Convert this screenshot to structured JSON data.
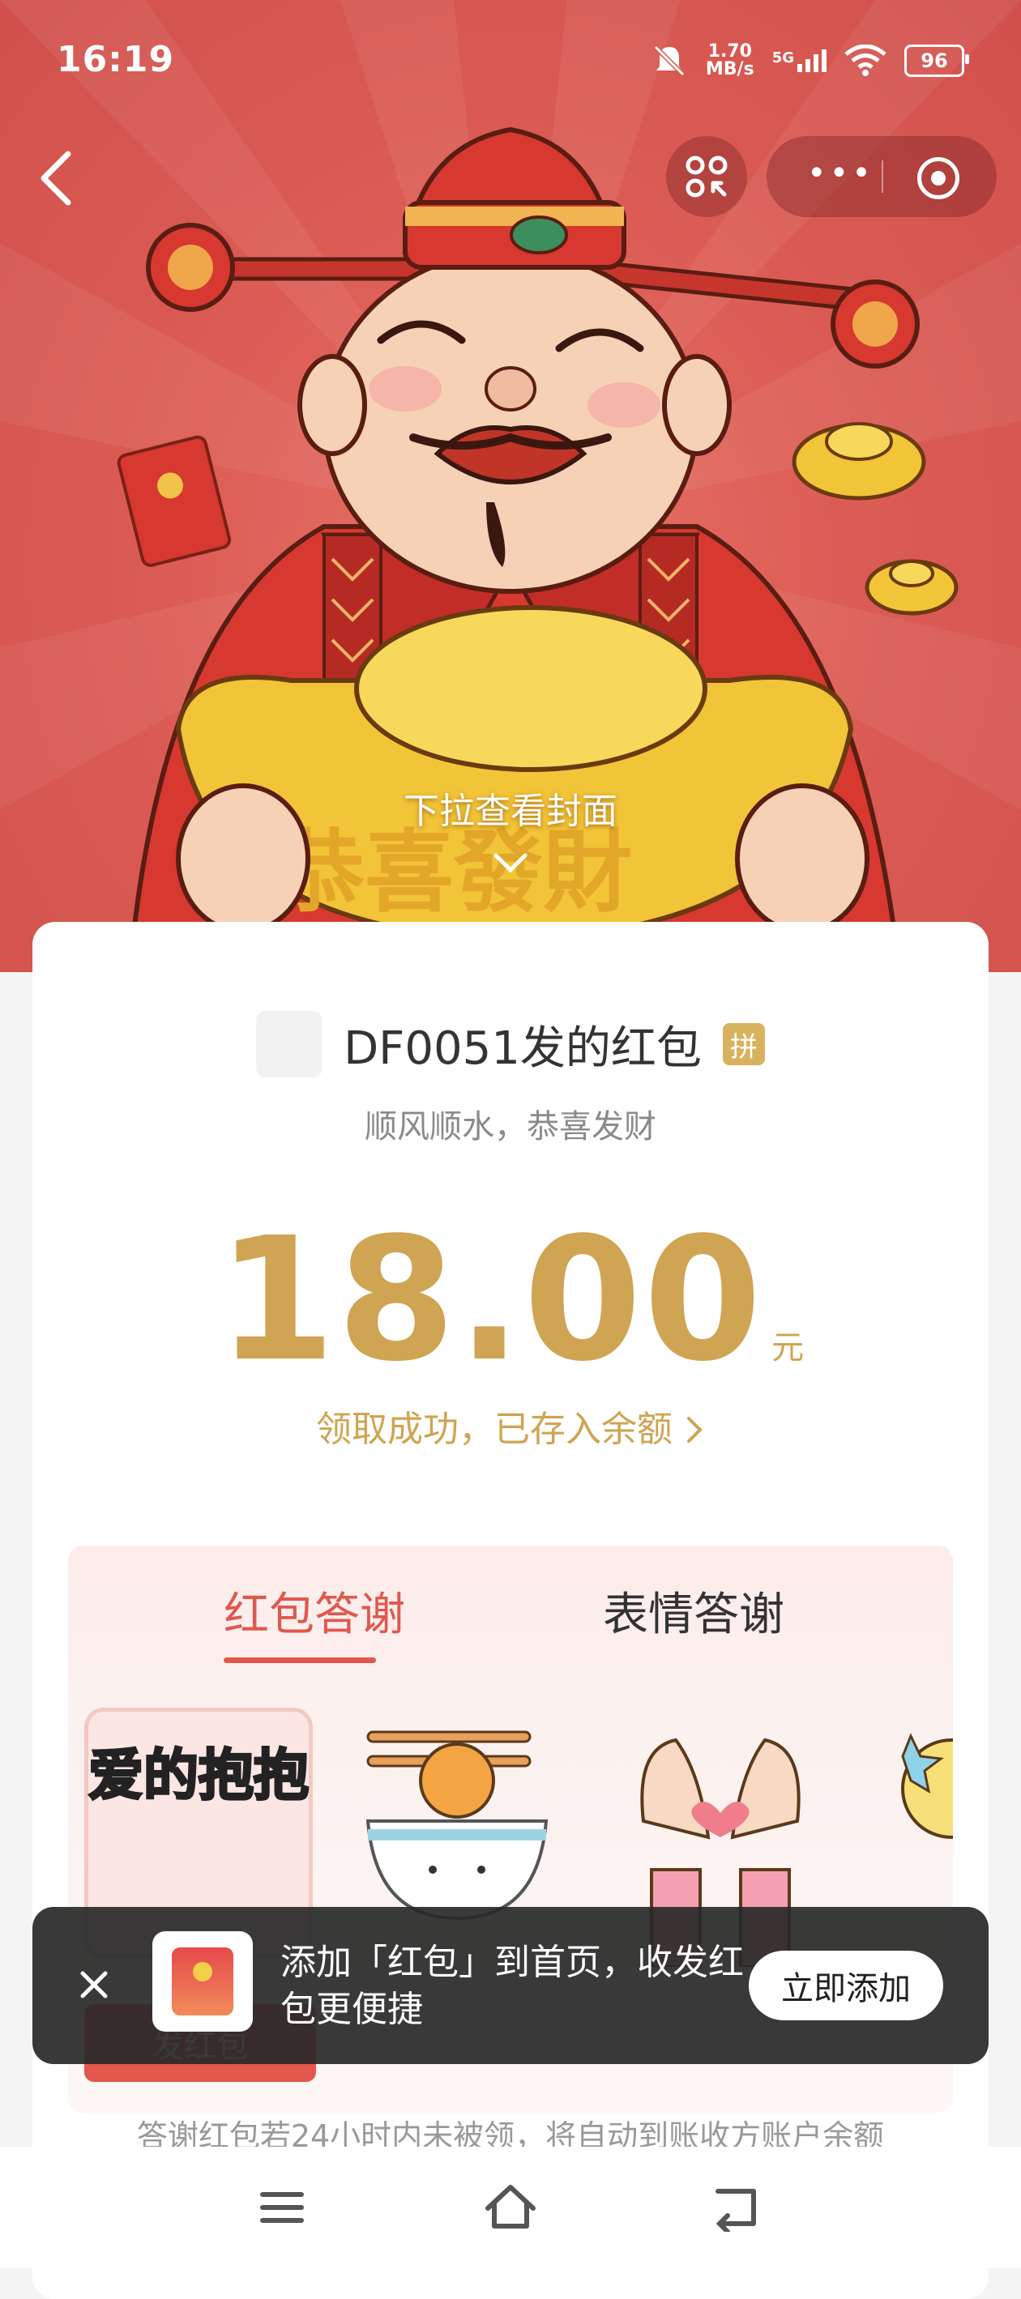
{
  "status_bar": {
    "time": "16:19",
    "net_speed_value": "1.70",
    "net_speed_unit": "MB/s",
    "network_type": "5G",
    "battery": "96"
  },
  "cover": {
    "hint": "下拉查看封面",
    "ingot_text": "恭喜發財"
  },
  "packet": {
    "sender": "DF0051发的红包",
    "badge": "拼",
    "wish": "顺风顺水，恭喜发财",
    "amount": "18.00",
    "unit": "元",
    "received": "领取成功，已存入余额"
  },
  "thanks": {
    "tabs": [
      {
        "label": "红包答谢",
        "active": true
      },
      {
        "label": "表情答谢",
        "active": false
      }
    ],
    "sticker1_text": "爱的抱抱",
    "send_button": "发红包",
    "note": "答谢红包若24小时内未被领，将自动到账收方账户余额"
  },
  "toast": {
    "text": "添加「红包」到首页，收发红包更便捷",
    "action": "立即添加"
  },
  "colors": {
    "hero_red": "#dc5d55",
    "gold": "#cfa452",
    "accent_red": "#e0584d"
  }
}
